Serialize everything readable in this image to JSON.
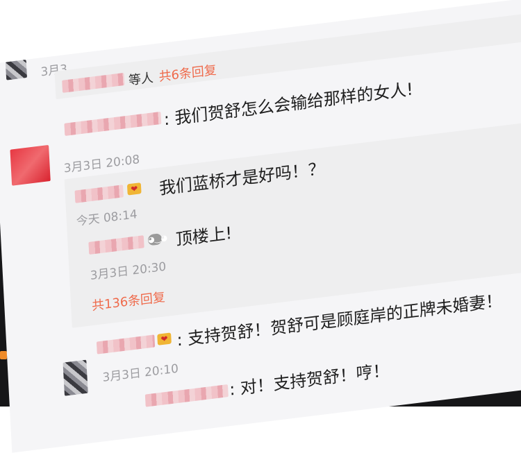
{
  "top_comment": {
    "time_partial": "3月3",
    "suffix": "等人",
    "reply_count": "共6条回复",
    "content": ": 我们贺舒怎么会输给那样的女人!"
  },
  "comment_1": {
    "time": "3月3日 20:08",
    "replies": [
      {
        "content": "我们蓝桥才是好吗！？",
        "time": "今天 08:14"
      },
      {
        "content": "顶楼上!",
        "time": "3月3日 20:30"
      }
    ],
    "reply_count": "共136条回复"
  },
  "comment_2": {
    "content": ": 支持贺舒！贺舒可是顾庭岸的正牌未婚妻！",
    "time": "3月3日 20:10"
  },
  "comment_3": {
    "content": ": 对！支持贺舒！哼！"
  },
  "edge_char": "回",
  "colors": {
    "accent_red": "#ef6a4b",
    "screen_bg": "#f5f5f7",
    "frame_black": "#161618"
  }
}
